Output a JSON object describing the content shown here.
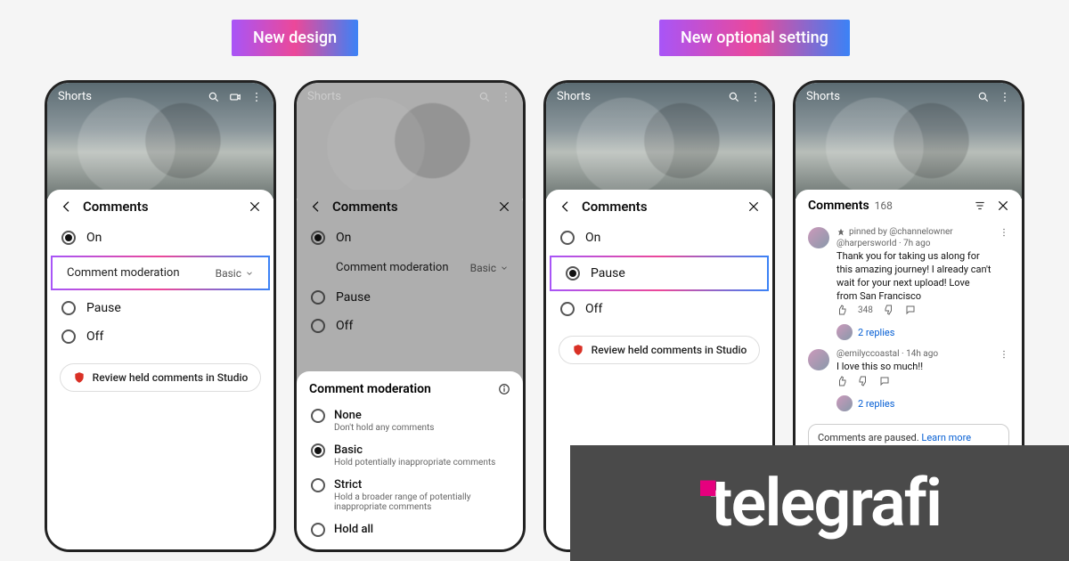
{
  "badges": {
    "left": "New design",
    "right": "New optional setting"
  },
  "video": {
    "tab": "Shorts"
  },
  "comments_sheet": {
    "title": "Comments",
    "options": {
      "on": "On",
      "pause": "Pause",
      "off": "Off"
    },
    "moderation_label": "Comment moderation",
    "moderation_value": "Basic",
    "review_label": "Review held comments in Studio"
  },
  "moderation_sheet": {
    "title": "Comment moderation",
    "options": [
      {
        "label": "None",
        "desc": "Don't hold any comments"
      },
      {
        "label": "Basic",
        "desc": "Hold potentially inappropriate comments"
      },
      {
        "label": "Strict",
        "desc": "Hold a broader range of potentially inappropriate comments"
      },
      {
        "label": "Hold all",
        "desc": ""
      }
    ]
  },
  "comments_panel": {
    "title": "Comments",
    "count": "168",
    "pinned_by": "pinned by @channelowner",
    "c1_user": "@harpersworld",
    "c1_time": "7h ago",
    "c1_text": "Thank you for taking us along for this amazing journey! I already can't wait for your next upload! Love from San Francisco",
    "c1_likes": "348",
    "c1_replies": "2 replies",
    "c2_user": "@emilyccoastal",
    "c2_time": "14h ago",
    "c2_text": "I love this so much!!",
    "c2_replies": "2 replies",
    "paused_text": "Comments are paused.",
    "learn_more": "Learn more"
  },
  "watermark": "telegrafi"
}
